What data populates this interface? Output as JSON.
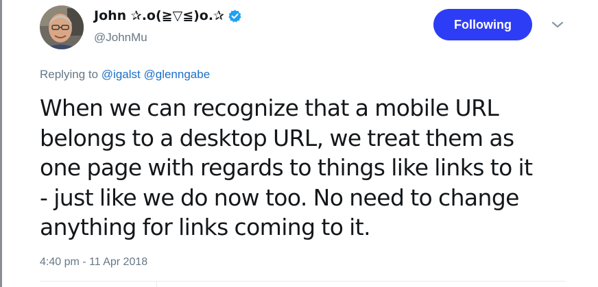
{
  "author": {
    "display_name": "John ✰.o(≧▽≦)o.✰",
    "handle": "@JohnMu",
    "verified": true
  },
  "follow_button": {
    "label": "Following"
  },
  "reply_context": {
    "prefix": "Replying to",
    "mentions": [
      "@igalst",
      "@glenngabe"
    ]
  },
  "tweet": {
    "lines": [
      "When we can recognize that a mobile URL",
      "belongs to a desktop URL, we treat them as",
      "one page with regards to things like links to it",
      "- just like we do now too. No need to change",
      "anything for links coming to it."
    ],
    "timestamp": "4:40 pm - 11 Apr 2018"
  },
  "icons": {
    "verified": "verified-badge-icon",
    "menu": "chevron-down-icon"
  },
  "colors": {
    "follow_button_bg": "#2d3df6",
    "mention": "#1b6fc7",
    "secondary_text": "#657786",
    "verified": "#1da1f2"
  }
}
